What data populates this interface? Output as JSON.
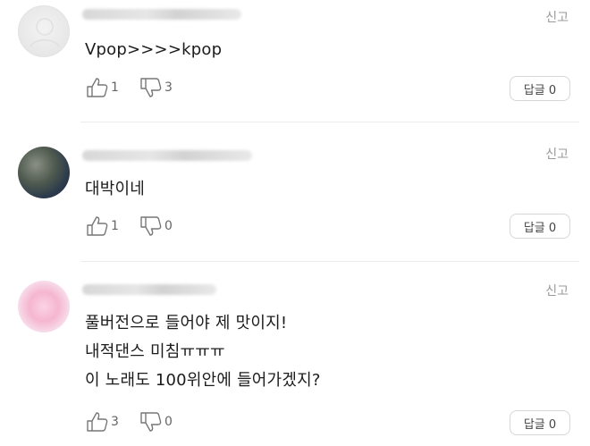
{
  "comments": [
    {
      "report_label": "신고",
      "lines": [
        "Vpop>>>>kpop"
      ],
      "likes": "1",
      "dislikes": "3",
      "reply_label": "답글 0"
    },
    {
      "report_label": "신고",
      "lines": [
        "대박이네"
      ],
      "likes": "1",
      "dislikes": "0",
      "reply_label": "답글 0"
    },
    {
      "report_label": "신고",
      "lines": [
        "풀버전으로 들어야 제 맛이지!",
        "내적댄스 미침ㅠㅠㅠ",
        "이 노래도 100위안에 들어가겠지?"
      ],
      "likes": "3",
      "dislikes": "0",
      "reply_label": "답글 0"
    }
  ]
}
